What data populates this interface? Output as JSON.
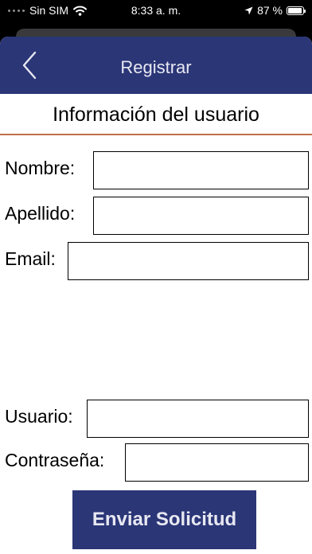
{
  "status_bar": {
    "carrier": "Sin SIM",
    "time": "8:33 a. m.",
    "battery_percent": "87 %",
    "battery_level": 0.87
  },
  "nav": {
    "title": "Registrar",
    "back_icon": "chevron-left-icon"
  },
  "section": {
    "title": "Información del usuario"
  },
  "form": {
    "nombre_label": "Nombre:",
    "nombre_value": "",
    "apellido_label": "Apellido:",
    "apellido_value": "",
    "email_label": "Email:",
    "email_value": "",
    "usuario_label": "Usuario:",
    "usuario_value": "",
    "password_label": "Contraseña:",
    "password_value": ""
  },
  "submit_label": "Enviar Solicitud",
  "colors": {
    "nav_background": "#2b3677",
    "divider": "#c0714a"
  }
}
